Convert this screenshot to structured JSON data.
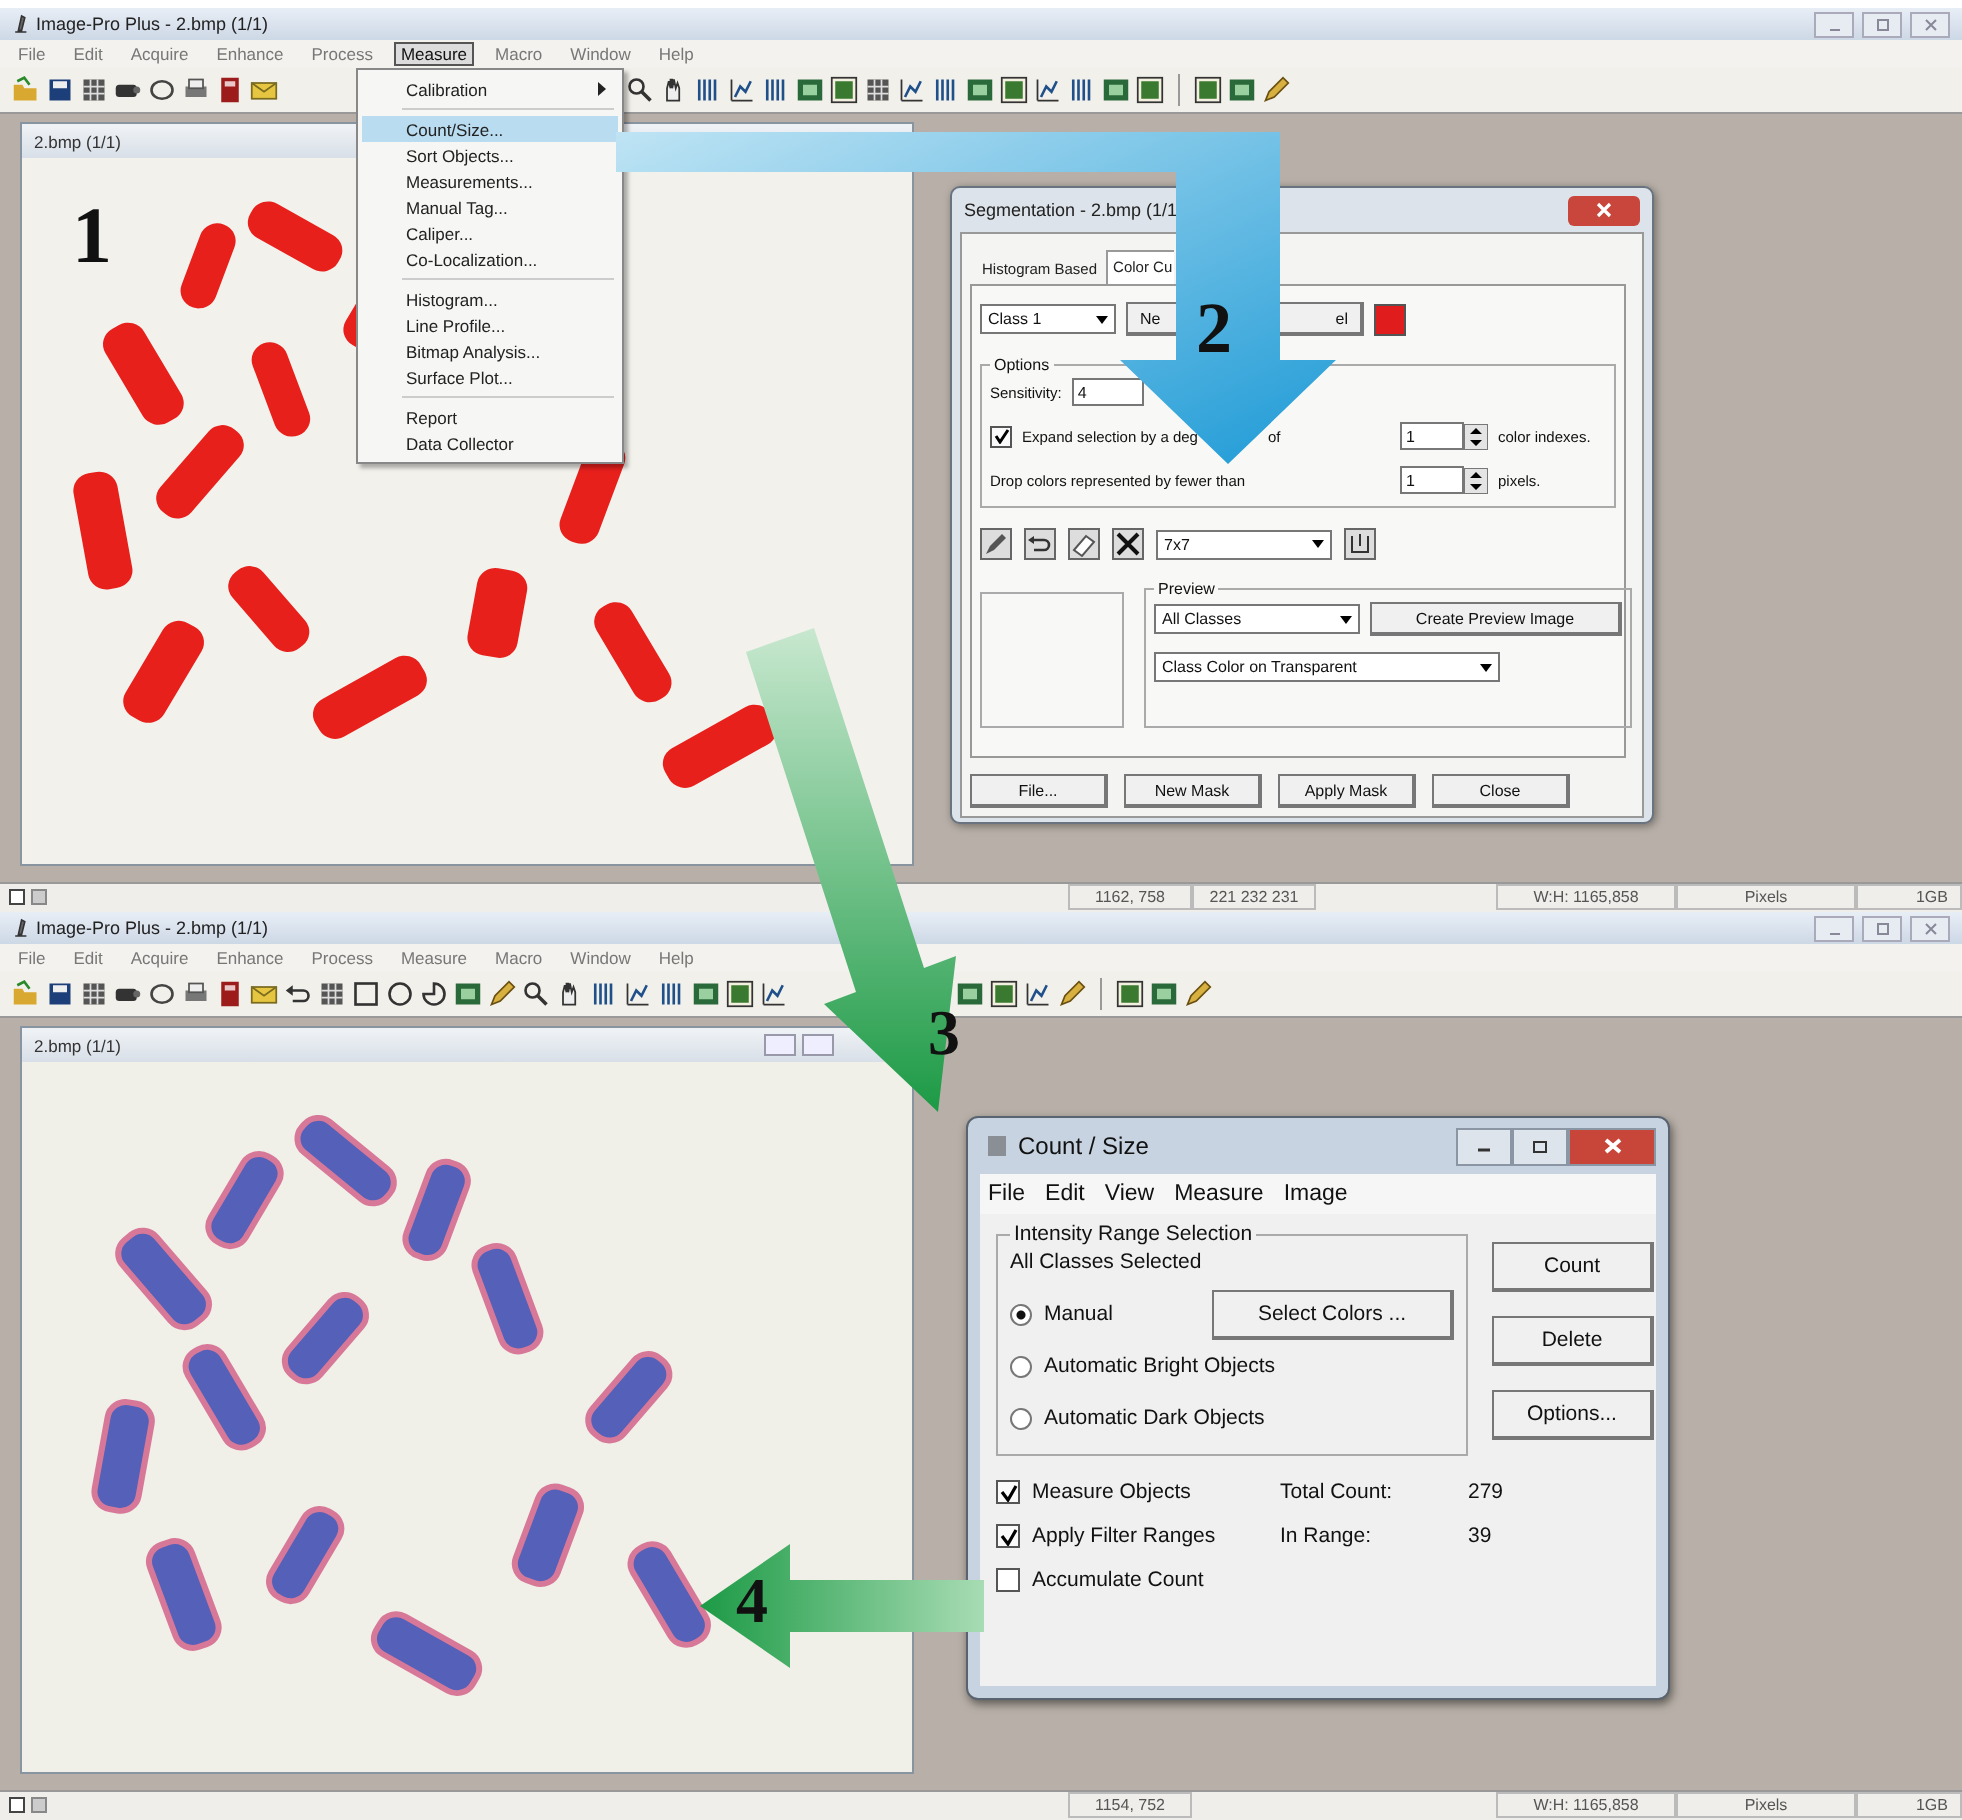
{
  "top_window": {
    "title": "Image-Pro Plus - 2.bmp (1/1)",
    "menu": [
      {
        "label": "File",
        "selected": false
      },
      {
        "label": "Edit",
        "selected": false
      },
      {
        "label": "Acquire",
        "selected": false
      },
      {
        "label": "Enhance",
        "selected": false
      },
      {
        "label": "Process",
        "selected": false
      },
      {
        "label": "Measure",
        "selected": true
      },
      {
        "label": "Macro",
        "selected": false
      },
      {
        "label": "Window",
        "selected": false
      },
      {
        "label": "Help",
        "selected": false
      }
    ],
    "image_window": {
      "title": "2.bmp (1/1)",
      "kind": "picture"
    },
    "status_bar": [
      {
        "kind": "coords",
        "text": "1162, 758"
      },
      {
        "kind": "color",
        "text": "221 232 231"
      },
      {
        "kind": "size",
        "text": "W:H: 1165,858"
      },
      {
        "kind": "units",
        "text": "Pixels"
      },
      {
        "kind": "memory",
        "text": "1GB"
      }
    ]
  },
  "measure_menu": {
    "groups": [
      [
        {
          "label": "Calibration",
          "submenu": true,
          "highlighted": false
        }
      ],
      [
        {
          "label": "Count/Size...",
          "submenu": false,
          "highlighted": true
        },
        {
          "label": "Sort Objects...",
          "submenu": false,
          "highlighted": false
        },
        {
          "label": "Measurements...",
          "submenu": false,
          "highlighted": false
        },
        {
          "label": "Manual Tag...",
          "submenu": false,
          "highlighted": false
        },
        {
          "label": "Caliper...",
          "submenu": false,
          "highlighted": false
        },
        {
          "label": "Co-Localization...",
          "submenu": false,
          "highlighted": false
        }
      ],
      [
        {
          "label": "Histogram...",
          "submenu": false,
          "highlighted": false
        },
        {
          "label": "Line Profile...",
          "submenu": false,
          "highlighted": false
        },
        {
          "label": "Bitmap Analysis...",
          "submenu": false,
          "highlighted": false
        },
        {
          "label": "Surface Plot...",
          "submenu": false,
          "highlighted": false
        }
      ],
      [
        {
          "label": "Report",
          "submenu": false,
          "highlighted": false
        },
        {
          "label": "Data Collector",
          "submenu": false,
          "highlighted": false
        }
      ]
    ]
  },
  "segmentation_dialog": {
    "title": "Segmentation - 2.bmp (1/1",
    "tabs": [
      {
        "label": "Histogram Based",
        "selected": false
      },
      {
        "label": "Color Cu",
        "selected": true
      }
    ],
    "class_select": "Class 1",
    "class_button_parts": [
      "Ne",
      "el"
    ],
    "options": {
      "legend": "Options",
      "sensitivity_label": "Sensitivity:",
      "sensitivity": "4",
      "expand": {
        "checked": true,
        "label_parts": [
          "Expand selection by a deg",
          "of"
        ],
        "value": "1",
        "unit": "color indexes."
      },
      "drop": {
        "label": "Drop colors represented by fewer than",
        "value": "1",
        "unit": "pixels."
      }
    },
    "brush_size": "7x7",
    "preview": {
      "legend": "Preview",
      "classes": "All Classes",
      "create_button": "Create Preview Image",
      "mode": "Class Color on Transparent"
    },
    "buttons": [
      "File...",
      "New Mask",
      "Apply Mask",
      "Close"
    ]
  },
  "bottom_window": {
    "title": "Image-Pro Plus - 2.bmp (1/1)",
    "menu": [
      {
        "label": "File",
        "selected": false
      },
      {
        "label": "Edit",
        "selected": false
      },
      {
        "label": "Acquire",
        "selected": false
      },
      {
        "label": "Enhance",
        "selected": false
      },
      {
        "label": "Process",
        "selected": false
      },
      {
        "label": "Measure",
        "selected": false
      },
      {
        "label": "Macro",
        "selected": false
      },
      {
        "label": "Window",
        "selected": false
      },
      {
        "label": "Help",
        "selected": false
      }
    ],
    "image_window": {
      "title": "2.bmp (1/1)",
      "kind": "picture"
    },
    "status_bar": [
      {
        "kind": "coords",
        "text": "1154, 752"
      },
      {
        "kind": "size",
        "text": "W:H: 1165,858"
      },
      {
        "kind": "units",
        "text": "Pixels"
      },
      {
        "kind": "memory",
        "text": "1GB"
      }
    ]
  },
  "count_size_dialog": {
    "title": "Count / Size",
    "menu": [
      "File",
      "Edit",
      "View",
      "Measure",
      "Image"
    ],
    "group_legend": "Intensity Range Selection",
    "classes_text": "All Classes Selected",
    "radios": [
      {
        "label": "Manual",
        "selected": true
      },
      {
        "label": "Automatic Bright Objects",
        "selected": false
      },
      {
        "label": "Automatic Dark Objects",
        "selected": false
      }
    ],
    "select_colors_button": "Select Colors ...",
    "side_buttons": [
      "Count",
      "Delete",
      "Options..."
    ],
    "checkboxes": [
      {
        "label": "Measure Objects",
        "checked": true
      },
      {
        "label": "Apply Filter Ranges",
        "checked": true
      },
      {
        "label": "Accumulate Count",
        "checked": false
      }
    ],
    "stats": [
      {
        "label": "Total Count:",
        "value": "279"
      },
      {
        "label": "In Range:",
        "value": "39"
      }
    ]
  },
  "step_labels": [
    "1",
    "2",
    "3",
    "4"
  ]
}
